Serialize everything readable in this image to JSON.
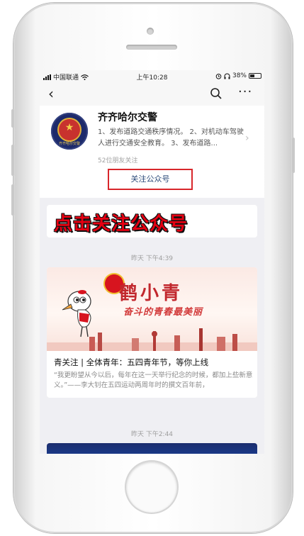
{
  "status_bar": {
    "carrier": "中国联通",
    "time": "上午10:28",
    "battery": "38%"
  },
  "nav": {
    "back_glyph": "‹",
    "more_glyph": "···"
  },
  "account": {
    "name": "齐齐哈尔交警",
    "description": "1、发布道路交通秩序情况。 2、对机动车驾驶人进行交通安全教育。 3、发布道路...",
    "friends_following": "52位朋友关注",
    "follow_button": "关注公众号",
    "logo_text": "齐齐哈尔交警"
  },
  "overlay": {
    "instruction": "点击关注公众号"
  },
  "feed": {
    "time_1": "昨天 下午4:39",
    "banner_title": "鹤小青",
    "banner_subtitle": "奋斗的青春最美丽",
    "article_title": "青关注 | 全体青年：五四青年节，等你上线",
    "article_excerpt": "“我更盼望从今以后，每年在这一天举行纪念的时候，都加上些新意义。”——李大钊在五四运动两周年时的撰文百年前，",
    "time_2": "昨天 下午2:44"
  },
  "colors": {
    "accent_red": "#d8262b",
    "link_blue": "#2d4b7a",
    "overlay_red": "#e60012"
  },
  "icons": [
    "signal-icon",
    "wifi-icon",
    "back-icon",
    "search-icon",
    "more-icon",
    "chevron-right-icon",
    "battery-icon",
    "alarm-icon",
    "headphones-icon"
  ]
}
